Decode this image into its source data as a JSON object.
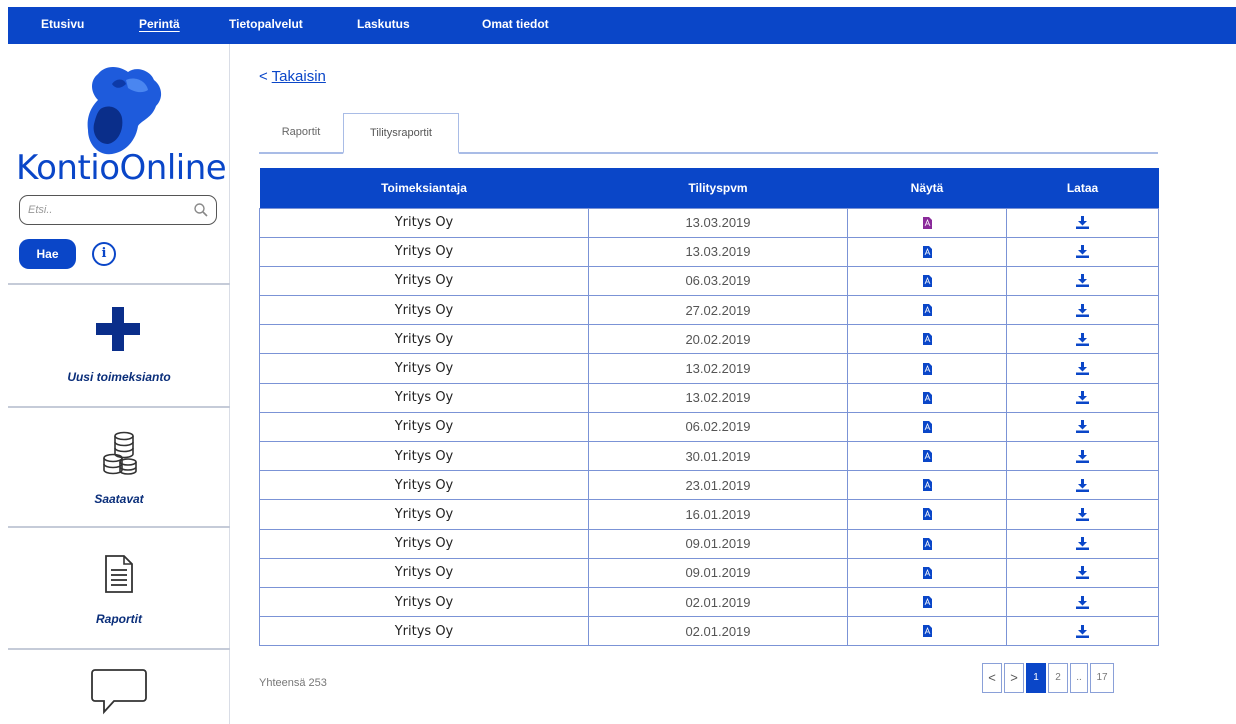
{
  "topnav": {
    "items": [
      {
        "label": "Etusivu"
      },
      {
        "label": "Perintä"
      },
      {
        "label": "Tietopalvelut"
      },
      {
        "label": "Laskutus"
      },
      {
        "label": "Omat tiedot"
      }
    ],
    "active_index": 1
  },
  "sidebar": {
    "logo_text": "KontioOnline",
    "search_placeholder": "Etsi..",
    "search_button": "Hae",
    "info_glyph": "i",
    "items": [
      {
        "label": "Uusi toimeksianto",
        "icon": "plus-icon"
      },
      {
        "label": "Saatavat",
        "icon": "coins-icon"
      },
      {
        "label": "Raportit",
        "icon": "document-icon"
      },
      {
        "label": "",
        "icon": "chat-bubble-icon"
      }
    ]
  },
  "main": {
    "back_prefix": "<",
    "back_label": "Takaisin",
    "tabs": [
      {
        "label": "Raportit"
      },
      {
        "label": "Tilitysraportit"
      }
    ],
    "active_tab": 1,
    "table": {
      "columns": [
        "Toimeksiantaja",
        "Tilityspvm",
        "Näytä",
        "Lataa"
      ],
      "rows": [
        {
          "client": "Yritys Oy",
          "date": "13.03.2019"
        },
        {
          "client": "Yritys Oy",
          "date": "13.03.2019"
        },
        {
          "client": "Yritys Oy",
          "date": "06.03.2019"
        },
        {
          "client": "Yritys Oy",
          "date": "27.02.2019"
        },
        {
          "client": "Yritys Oy",
          "date": "20.02.2019"
        },
        {
          "client": "Yritys Oy",
          "date": "13.02.2019"
        },
        {
          "client": "Yritys Oy",
          "date": "13.02.2019"
        },
        {
          "client": "Yritys Oy",
          "date": "06.02.2019"
        },
        {
          "client": "Yritys Oy",
          "date": "30.01.2019"
        },
        {
          "client": "Yritys Oy",
          "date": "23.01.2019"
        },
        {
          "client": "Yritys Oy",
          "date": "16.01.2019"
        },
        {
          "client": "Yritys Oy",
          "date": "09.01.2019"
        },
        {
          "client": "Yritys Oy",
          "date": "09.01.2019"
        },
        {
          "client": "Yritys Oy",
          "date": "02.01.2019"
        },
        {
          "client": "Yritys Oy",
          "date": "02.01.2019"
        }
      ],
      "view_icon": "pdf-icon",
      "download_icon": "download-icon"
    },
    "total_text": "Yhteensä 253",
    "pagination": {
      "prev": "<",
      "next": ">",
      "pages": [
        "1",
        "2",
        "..",
        "17"
      ],
      "current": "1"
    }
  },
  "colors": {
    "brand_blue": "#0a46c8",
    "pdf_first_row": "#8a2a9a"
  }
}
